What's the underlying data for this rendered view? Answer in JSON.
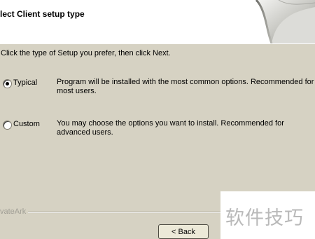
{
  "header": {
    "title": "lect Client setup type"
  },
  "instruction": "Click the type of Setup you prefer, then click Next.",
  "options": [
    {
      "label": "Typical",
      "selected": true,
      "description": "Program will be installed with the most common options.  Recommended for most users."
    },
    {
      "label": "Custom",
      "selected": false,
      "description": "You may choose the options you want to install. Recommended for advanced users."
    }
  ],
  "footer": {
    "brand": "vateArk",
    "back_label": "< Back"
  },
  "watermark": "软件技巧",
  "colors": {
    "dialog_bg": "#d6d2c3",
    "header_bg": "#ffffff",
    "button_bg": "#ece9d8"
  }
}
